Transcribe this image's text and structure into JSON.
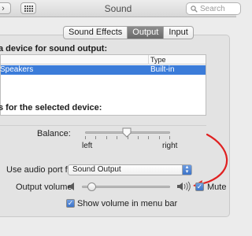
{
  "window": {
    "title": "Sound",
    "search_placeholder": "Search"
  },
  "tabs": [
    {
      "label": "Sound Effects",
      "active": false
    },
    {
      "label": "Output",
      "active": true
    },
    {
      "label": "Input",
      "active": false
    }
  ],
  "output": {
    "select_heading": "a device for sound output:",
    "table": {
      "header_type": "Type",
      "rows": [
        {
          "name": "l Speakers",
          "type": "Built-in",
          "selected": true
        }
      ]
    },
    "settings_heading": "s for the selected device:",
    "balance": {
      "label": "Balance:",
      "left_label": "left",
      "right_label": "right",
      "value": 0.5
    },
    "audio_port": {
      "label": "Use audio port for:",
      "value": "Sound Output"
    },
    "volume": {
      "label": "Output volume:",
      "value": 0.1,
      "mute_label": "Mute",
      "mute_checked": true
    },
    "menu_bar": {
      "label": "Show volume in menu bar",
      "checked": true
    }
  },
  "colors": {
    "selection": "#3b7cd9",
    "annotation_arrow": "#e02020"
  }
}
